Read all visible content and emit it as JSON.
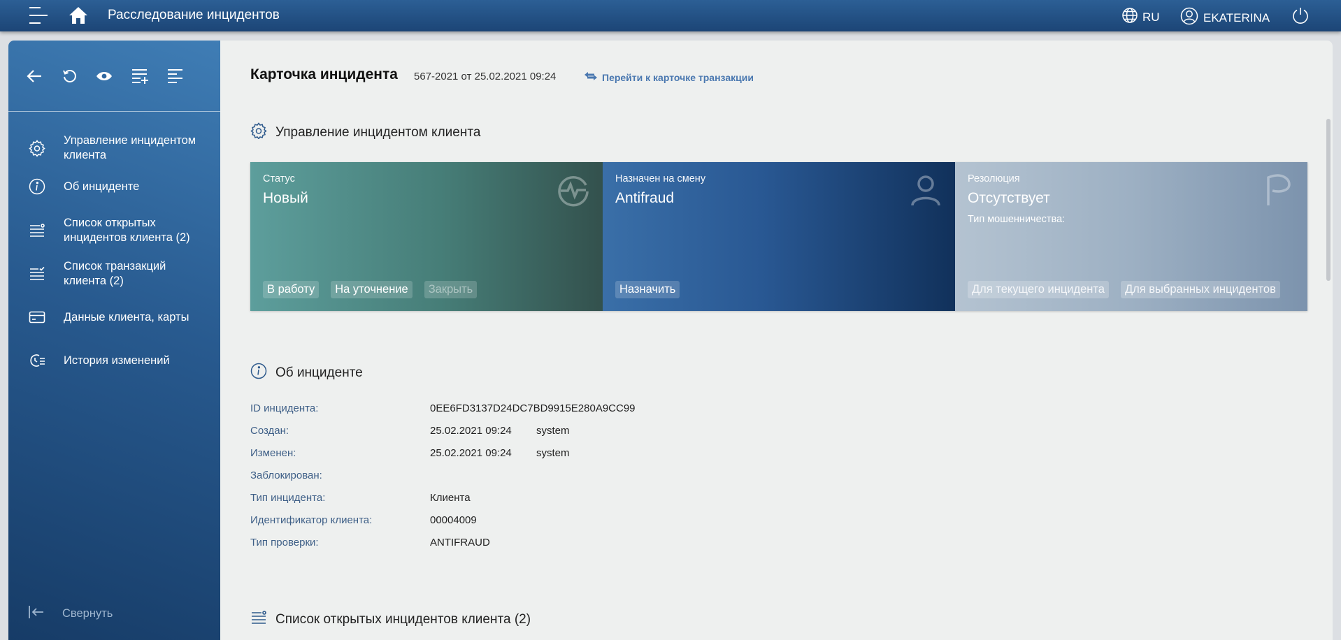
{
  "header": {
    "app_title": "Расследование инцидентов",
    "lang": "RU",
    "user": "EKATERINA"
  },
  "sidebar": {
    "items": [
      {
        "label": "Управление инцидентом клиента",
        "icon": "gear-icon"
      },
      {
        "label": "Об инциденте",
        "icon": "info-icon"
      },
      {
        "label": "Список открытых инцидентов клиента (2)",
        "icon": "list-icon"
      },
      {
        "label": "Список транзакций клиента (2)",
        "icon": "list-check-icon"
      },
      {
        "label": "Данные клиента, карты",
        "icon": "card-icon"
      },
      {
        "label": "История изменений",
        "icon": "history-icon"
      }
    ],
    "collapse_label": "Свернуть"
  },
  "card": {
    "title": "Карточка инцидента",
    "subtitle": "567-2021 от 25.02.2021 09:24",
    "transaction_link": "Перейти к карточке транзакции"
  },
  "management": {
    "heading": "Управление инцидентом клиента",
    "status": {
      "label": "Статус",
      "value": "Новый",
      "buttons": [
        "В работу",
        "На уточнение",
        "Закрыть"
      ]
    },
    "assign": {
      "label": "Назначен на смену",
      "value": "Antifraud",
      "button": "Назначить"
    },
    "resolution": {
      "label": "Резолюция",
      "value": "Отсутствует",
      "fraud_type_label": "Тип мошенничества:",
      "buttons": [
        "Для текущего инцидента",
        "Для выбранных инцидентов"
      ]
    }
  },
  "about": {
    "heading": "Об инциденте",
    "rows": [
      {
        "key": "ID инцидента:",
        "value": "0EE6FD3137D24DC7BD9915E280A9CC99",
        "user": ""
      },
      {
        "key": "Создан:",
        "value": "25.02.2021 09:24",
        "user": "system"
      },
      {
        "key": "Изменен:",
        "value": "25.02.2021 09:24",
        "user": "system"
      },
      {
        "key": "Заблокирован:",
        "value": "",
        "user": ""
      },
      {
        "key": "Тип инцидента:",
        "value": "Клиента",
        "user": ""
      },
      {
        "key": "Идентификатор клиента:",
        "value": "00004009",
        "user": ""
      },
      {
        "key": "Тип проверки:",
        "value": "ANTIFRAUD",
        "user": ""
      }
    ]
  },
  "open_incidents": {
    "heading": "Список открытых инцидентов клиента (2)"
  },
  "colors": {
    "topbar": "#245387",
    "status_panel": "#4f8a86",
    "assign_panel": "#295893",
    "resolution_panel": "#9db0c3",
    "key_text": "#3e5f87",
    "link": "#4a78b0"
  }
}
